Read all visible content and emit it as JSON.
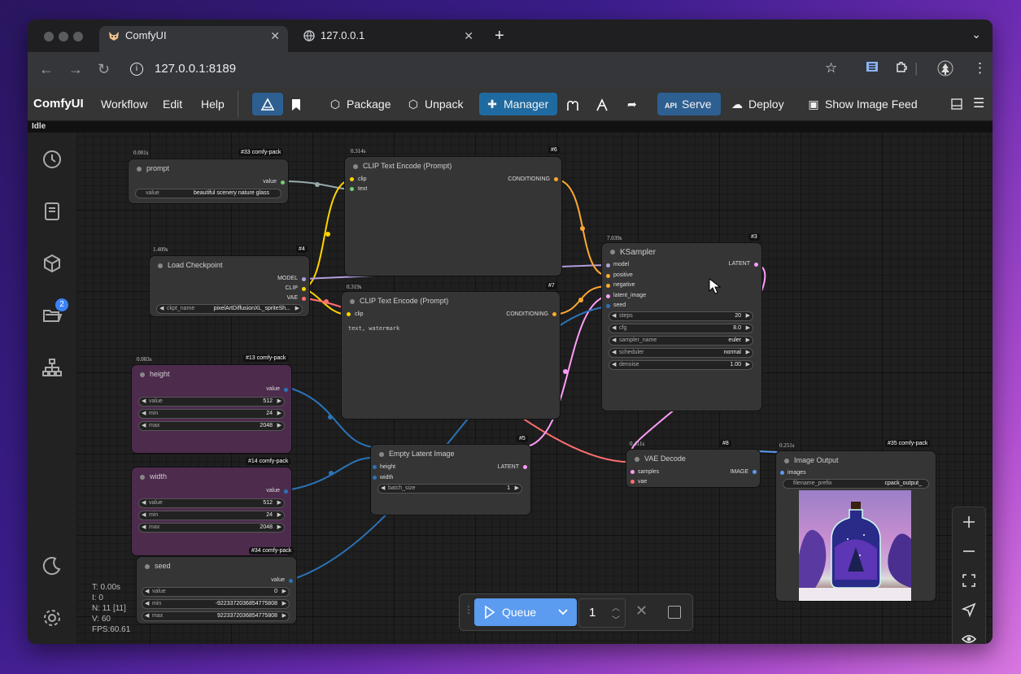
{
  "browser": {
    "tabs": [
      {
        "title": "ComfyUI"
      },
      {
        "title": "127.0.0.1"
      }
    ],
    "address": "127.0.0.1:8189"
  },
  "app": {
    "name": "ComfyUI",
    "menus": [
      "Workflow",
      "Edit",
      "Help"
    ],
    "toolbar": {
      "package": "Package",
      "unpack": "Unpack",
      "manager": "Manager",
      "api_tag": "API",
      "serve": "Serve",
      "deploy": "Deploy",
      "image_feed": "Show Image Feed"
    },
    "status": "Idle",
    "sidebar_badge": "2"
  },
  "nodes": {
    "prompt": {
      "time": "0.001s",
      "tag": "#33 comfy-pack",
      "title": "prompt",
      "out": "value",
      "w_label": "value",
      "w_value": "beautiful scenery nature glass"
    },
    "clip6": {
      "time": "0.314s",
      "tag": "#6",
      "title": "CLIP Text Encode (Prompt)",
      "in1": "clip",
      "in2": "text",
      "out": "CONDITIONING"
    },
    "ckpt": {
      "time": "1.409s",
      "tag": "#4",
      "title": "Load Checkpoint",
      "out1": "MODEL",
      "out2": "CLIP",
      "out3": "VAE",
      "w_label": "ckpt_name",
      "w_value": "pixelArtDiffusionXL_spriteSh..."
    },
    "clip7": {
      "time": "0.319s",
      "tag": "#7",
      "title": "CLIP Text Encode (Prompt)",
      "in1": "clip",
      "out": "CONDITIONING",
      "text": "text, watermark"
    },
    "ksampler": {
      "time": "7.039s",
      "tag": "#3",
      "title": "KSampler",
      "ins": [
        "model",
        "positive",
        "negative",
        "latent_image",
        "seed"
      ],
      "out": "LATENT",
      "widgets": [
        {
          "label": "steps",
          "value": "20"
        },
        {
          "label": "cfg",
          "value": "8.0"
        },
        {
          "label": "sampler_name",
          "value": "euler"
        },
        {
          "label": "scheduler",
          "value": "normal"
        },
        {
          "label": "denoise",
          "value": "1.00"
        }
      ]
    },
    "height": {
      "time": "0.003s",
      "tag": "#13 comfy-pack",
      "title": "height",
      "out": "value",
      "widgets": [
        {
          "label": "value",
          "value": "512"
        },
        {
          "label": "min",
          "value": "24"
        },
        {
          "label": "max",
          "value": "2048"
        }
      ]
    },
    "latent": {
      "tag": "#5",
      "title": "Empty Latent Image",
      "in1": "height",
      "in2": "width",
      "out": "LATENT",
      "w_label": "batch_size",
      "w_value": "1"
    },
    "vae": {
      "time": "0.411s",
      "tag": "#8",
      "title": "VAE Decode",
      "in1": "samples",
      "in2": "vae",
      "out": "IMAGE"
    },
    "output": {
      "time": "0.251s",
      "tag": "#35 comfy-pack",
      "title": "Image Output",
      "in1": "images",
      "w_label": "filename_prefix",
      "w_value": "cpack_output_"
    },
    "width": {
      "tag": "#14 comfy-pack",
      "title": "width",
      "out": "value",
      "widgets": [
        {
          "label": "value",
          "value": "512"
        },
        {
          "label": "min",
          "value": "24"
        },
        {
          "label": "max",
          "value": "2048"
        }
      ]
    },
    "seed": {
      "tag": "#34 comfy-pack",
      "title": "seed",
      "out": "value",
      "widgets": [
        {
          "label": "value",
          "value": "0"
        },
        {
          "label": "min",
          "value": "-9223372036854775808"
        },
        {
          "label": "max",
          "value": "9223372036854775808"
        }
      ]
    }
  },
  "stats": {
    "t": "T: 0.00s",
    "i": "I: 0",
    "n": "N: 11 [11]",
    "v": "V: 60",
    "fps": "FPS:60.61"
  },
  "queue": {
    "label": "Queue",
    "count": "1"
  },
  "colors": {
    "accent": "#2d5f91",
    "queue": "#5b9bf0",
    "clip_link": "#ffd500",
    "model_link": "#b39ddb",
    "vae_link": "#ff6e6e",
    "latent_link": "#ff9cf9",
    "int_link": "#2a73b8",
    "cond_link": "#ffa931"
  }
}
